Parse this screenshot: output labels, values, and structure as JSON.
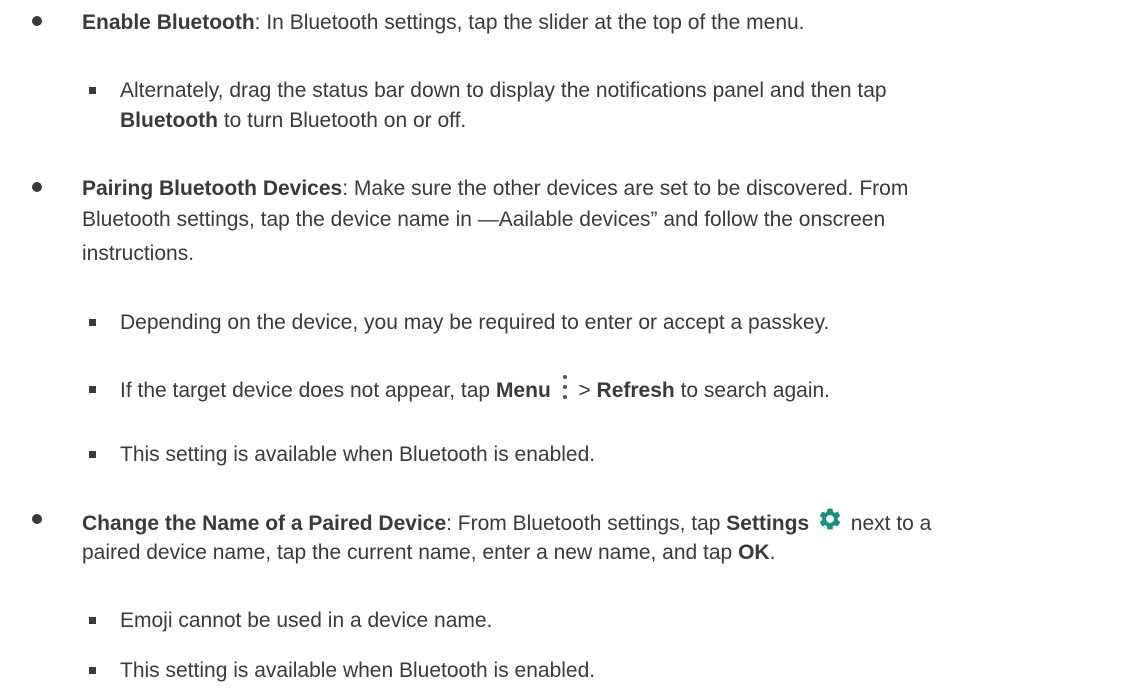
{
  "items": [
    {
      "label": "Enable Bluetooth",
      "text": ": In Bluetooth settings, tap the slider at the top of the menu.",
      "subitems": [
        {
          "text_before": "Alternately, drag the status bar down to display the notifications panel and then tap",
          "bold": "Bluetooth",
          "text_after": " to turn Bluetooth on or off."
        }
      ]
    },
    {
      "label": "Pairing Bluetooth Devices",
      "line1": ": Make sure the other devices are set to be discovered. From",
      "line2": "Bluetooth settings, tap the device name in —Αailable devices” and follow the onscreen",
      "line3": "instructions.",
      "subitems": [
        {
          "text": "Depending on the device, you may be required to enter or accept a passkey."
        },
        {
          "text_before": "If the target device does not appear, tap ",
          "bold1": "Menu",
          "sep": " > ",
          "bold2": "Refresh",
          "text_after": " to search again."
        },
        {
          "text": "This setting is available when Bluetooth is enabled."
        }
      ]
    },
    {
      "label": "Change the Name of a Paired Device",
      "text_before": ": From Bluetooth settings, tap ",
      "bold": "Settings",
      "text_after": " next to a",
      "line2_before": "paired device name, tap the current name, enter a new name, and tap ",
      "line2_bold": "OK",
      "line2_after": ".",
      "subitems": [
        {
          "text": "Emoji cannot be used in a device name."
        },
        {
          "text": "This setting is available when Bluetooth is enabled."
        }
      ]
    }
  ],
  "icons": {
    "menu": "three-dot-vertical-menu-icon",
    "settings": "gear-icon",
    "settings_color": "#1a8f7e"
  }
}
